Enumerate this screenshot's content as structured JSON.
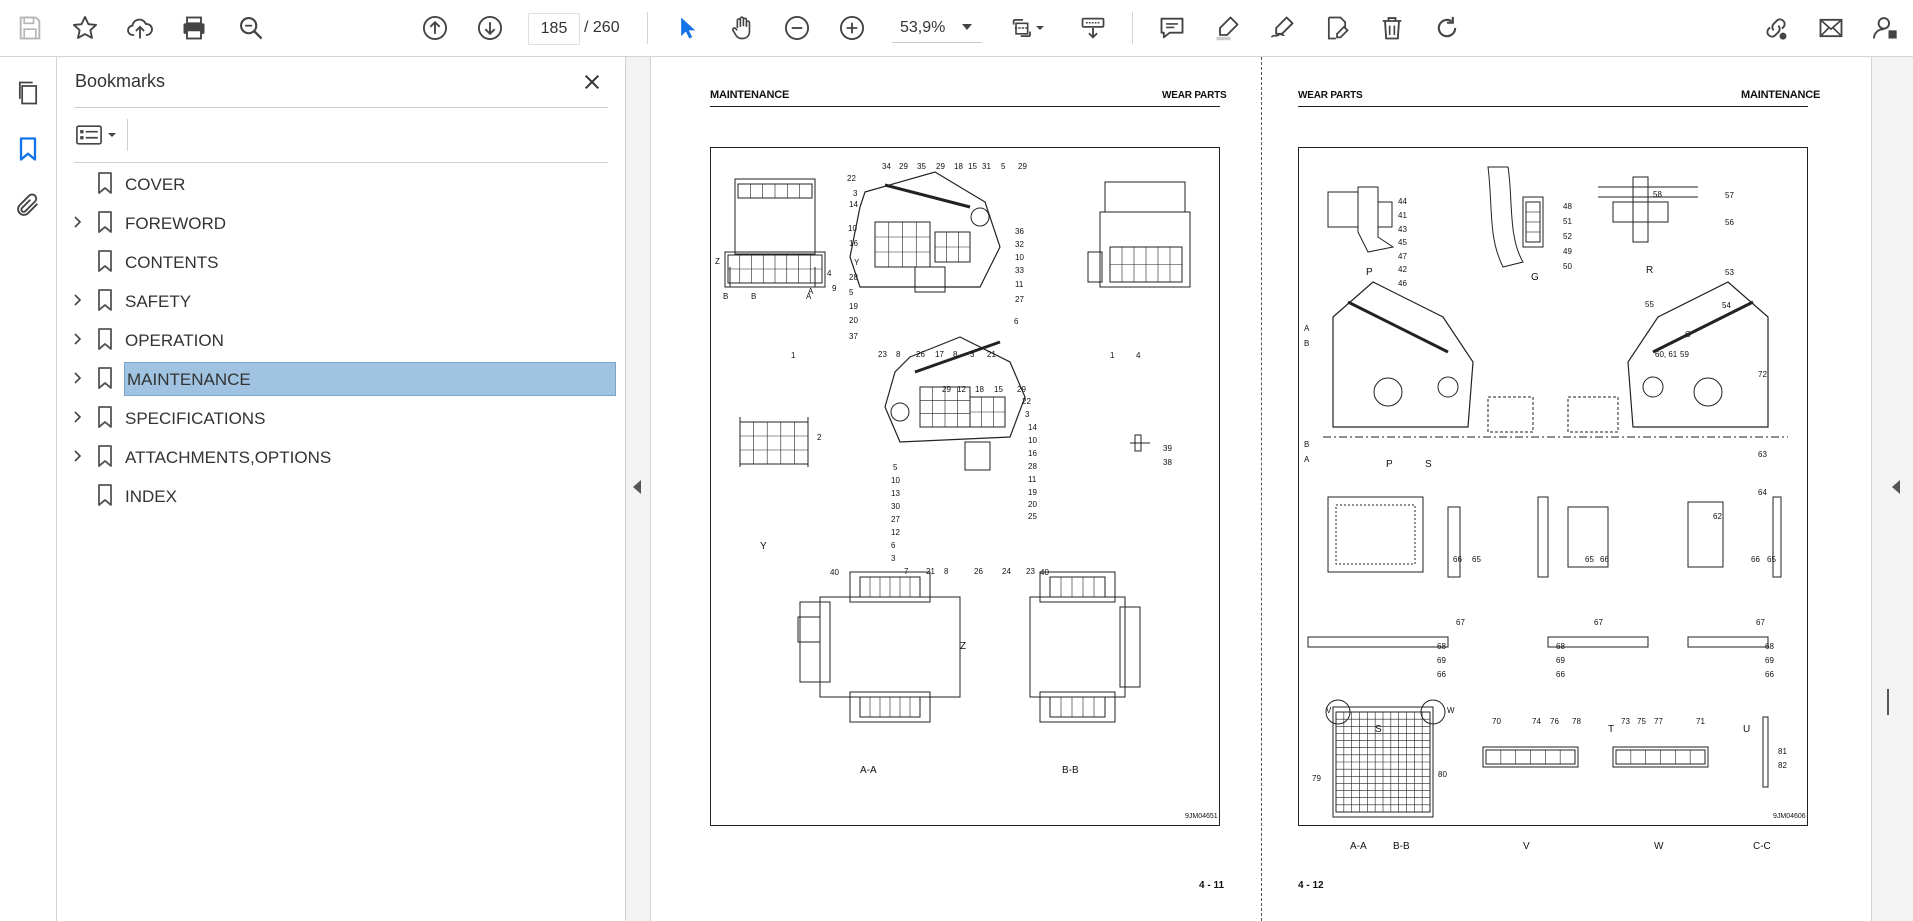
{
  "toolbar": {
    "page_current": "185",
    "page_total": "/  260",
    "zoom_value": "53,9%"
  },
  "panel": {
    "title": "Bookmarks",
    "items": [
      {
        "label": "COVER",
        "expandable": false,
        "selected": false
      },
      {
        "label": "FOREWORD",
        "expandable": true,
        "selected": false
      },
      {
        "label": "CONTENTS",
        "expandable": false,
        "selected": false
      },
      {
        "label": "SAFETY",
        "expandable": true,
        "selected": false
      },
      {
        "label": "OPERATION",
        "expandable": true,
        "selected": false
      },
      {
        "label": "MAINTENANCE",
        "expandable": true,
        "selected": true
      },
      {
        "label": "SPECIFICATIONS",
        "expandable": true,
        "selected": false
      },
      {
        "label": "ATTACHMENTS,OPTIONS",
        "expandable": true,
        "selected": false
      },
      {
        "label": "INDEX",
        "expandable": false,
        "selected": false
      }
    ]
  },
  "left_page": {
    "header_left": "MAINTENANCE",
    "header_right": "WEAR PARTS",
    "page_number": "4 - 11",
    "drawing_code": "9JM04651",
    "view_labels": [
      "Y",
      "Z",
      "A-A",
      "B-B"
    ],
    "callouts": [
      "34",
      "29",
      "35",
      "29",
      "18",
      "15",
      "31",
      "5",
      "29",
      "22",
      "3",
      "14",
      "10",
      "16",
      "Y",
      "28",
      "5",
      "19",
      "20",
      "37",
      "23",
      "8",
      "26",
      "17",
      "8",
      "3",
      "21",
      "36",
      "32",
      "10",
      "33",
      "11",
      "27",
      "6",
      "1",
      "4",
      "9",
      "B",
      "B",
      "A",
      "A",
      "Z",
      "1",
      "4",
      "2",
      "29",
      "12",
      "18",
      "15",
      "29",
      "22",
      "3",
      "14",
      "10",
      "16",
      "28",
      "11",
      "19",
      "20",
      "25",
      "5",
      "10",
      "13",
      "30",
      "27",
      "12",
      "6",
      "3",
      "7",
      "21",
      "8",
      "26",
      "24",
      "23",
      "39",
      "38",
      "40",
      "40"
    ]
  },
  "right_page": {
    "header_left": "WEAR PARTS",
    "header_right": "MAINTENANCE",
    "page_number": "4 - 12",
    "drawing_code": "9JM04606",
    "view_labels": [
      "P",
      "G",
      "R",
      "P",
      "S",
      "S",
      "T",
      "U",
      "A-A",
      "B-B",
      "V",
      "W",
      "C-C"
    ],
    "callouts": [
      "44",
      "41",
      "43",
      "45",
      "47",
      "42",
      "46",
      "48",
      "51",
      "52",
      "49",
      "50",
      "58",
      "57",
      "56",
      "53",
      "55",
      "54",
      "A",
      "B",
      "C",
      "60, 61",
      "59",
      "72",
      "B",
      "A",
      "63",
      "64",
      "62",
      "66",
      "65",
      "67",
      "65",
      "66",
      "67",
      "66",
      "65",
      "67",
      "68",
      "69",
      "66",
      "68",
      "69",
      "66",
      "68",
      "69",
      "66",
      "V",
      "W",
      "79",
      "80",
      "70",
      "74",
      "76",
      "78",
      "73",
      "75",
      "77",
      "71",
      "81",
      "82"
    ]
  }
}
